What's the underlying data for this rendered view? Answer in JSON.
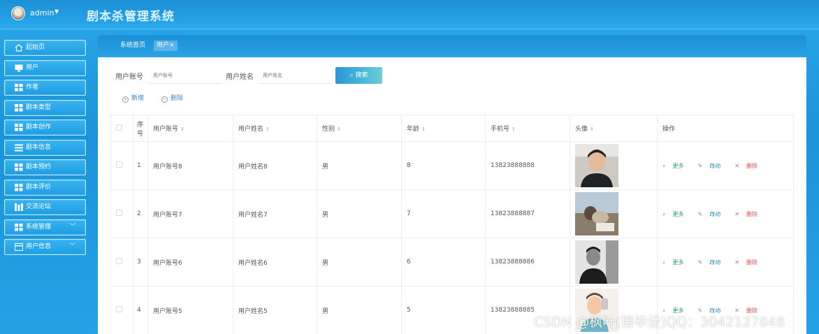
{
  "header": {
    "user": "admin",
    "caret": "▼",
    "title": "剧本杀管理系统"
  },
  "sidebar": {
    "items": [
      {
        "label": "起始页",
        "icon": "home-icon"
      },
      {
        "label": "用户",
        "icon": "monitor-icon"
      },
      {
        "label": "作者",
        "icon": "grid-icon"
      },
      {
        "label": "剧本类型",
        "icon": "grid-icon"
      },
      {
        "label": "剧本创作",
        "icon": "grid-icon"
      },
      {
        "label": "剧本信息",
        "icon": "list-icon"
      },
      {
        "label": "剧本预约",
        "icon": "grid-icon"
      },
      {
        "label": "剧本评价",
        "icon": "grid-icon"
      },
      {
        "label": "交流论坛",
        "icon": "bar-icon"
      },
      {
        "label": "系统管理",
        "icon": "grid-icon",
        "caret": "﹀"
      },
      {
        "label": "用户信息",
        "icon": "card-icon",
        "caret": "﹀"
      }
    ]
  },
  "breadcrumb": {
    "home": "系统首页",
    "current": "用户",
    "close": "×"
  },
  "search": {
    "account_label": "用户账号",
    "account_placeholder": "用户账号",
    "name_label": "用户姓名",
    "name_placeholder": "用户姓名",
    "button": "搜索",
    "button_icon": "⌕"
  },
  "actions": {
    "add": "新增",
    "add_icon": "+",
    "delete": "删除",
    "delete_icon": "−"
  },
  "table": {
    "columns": [
      "序号",
      "用户账号",
      "用户姓名",
      "性别",
      "年龄",
      "手机号",
      "头像",
      "操作"
    ],
    "sort_icon": "⇕",
    "rows": [
      {
        "index": "1",
        "account": "用户账号8",
        "name": "用户姓名8",
        "gender": "男",
        "age": "8",
        "phone": "13823888888"
      },
      {
        "index": "2",
        "account": "用户账号7",
        "name": "用户姓名7",
        "gender": "男",
        "age": "7",
        "phone": "13823888887"
      },
      {
        "index": "3",
        "account": "用户账号6",
        "name": "用户姓名6",
        "gender": "男",
        "age": "6",
        "phone": "13823888886"
      },
      {
        "index": "4",
        "account": "用户账号5",
        "name": "用户姓名5",
        "gender": "男",
        "age": "5",
        "phone": "13823888885"
      }
    ],
    "ops": {
      "more": "更多",
      "edit": "改动",
      "delete": "删除"
    }
  },
  "watermark": "CSDN @枫叶(接毕设)QQ：3042127848"
}
